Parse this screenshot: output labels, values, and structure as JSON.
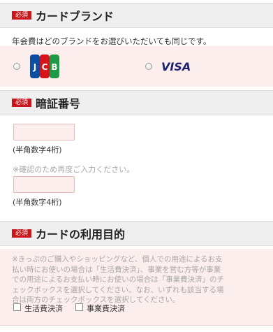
{
  "required_badge": "必須",
  "card_brand": {
    "title": "カードブランド",
    "note": "年会費はどのブランドをお選びいただいても同じです。",
    "options": [
      {
        "name": "JCB",
        "selected": false
      },
      {
        "name": "VISA",
        "selected": false
      }
    ]
  },
  "pin": {
    "title": "暗証番号",
    "input_hint": "(半角数字4桁)",
    "confirm_prompt": "※確認のため再度ご入力ください。",
    "confirm_hint": "(半角数字4桁)"
  },
  "purpose": {
    "title": "カードの利用目的",
    "note_lines": [
      "※きっぷのご購入やショッピングなど、個人での用途によるお支",
      "払い時にお使いの場合は「生活費決済」、事業を営む方等が事業",
      "での用途によるお支払い時にお使いの場合は「事業費決済」のチ",
      "ェックボックスを選択してください。なお、いずれも該当する場",
      "合は両方のチェックボックスを選択してください。"
    ],
    "options": [
      {
        "label": "生活費決済",
        "checked": false
      },
      {
        "label": "事業費決済",
        "checked": false
      }
    ]
  },
  "colors": {
    "badge": "#c8161d",
    "header_bg": "#efefef",
    "pink_bg": "#fdeeee",
    "visa_blue": "#1a1f71",
    "jcb_blue": "#0b4ea2",
    "jcb_red": "#d7141a",
    "jcb_green": "#1c9a46"
  }
}
